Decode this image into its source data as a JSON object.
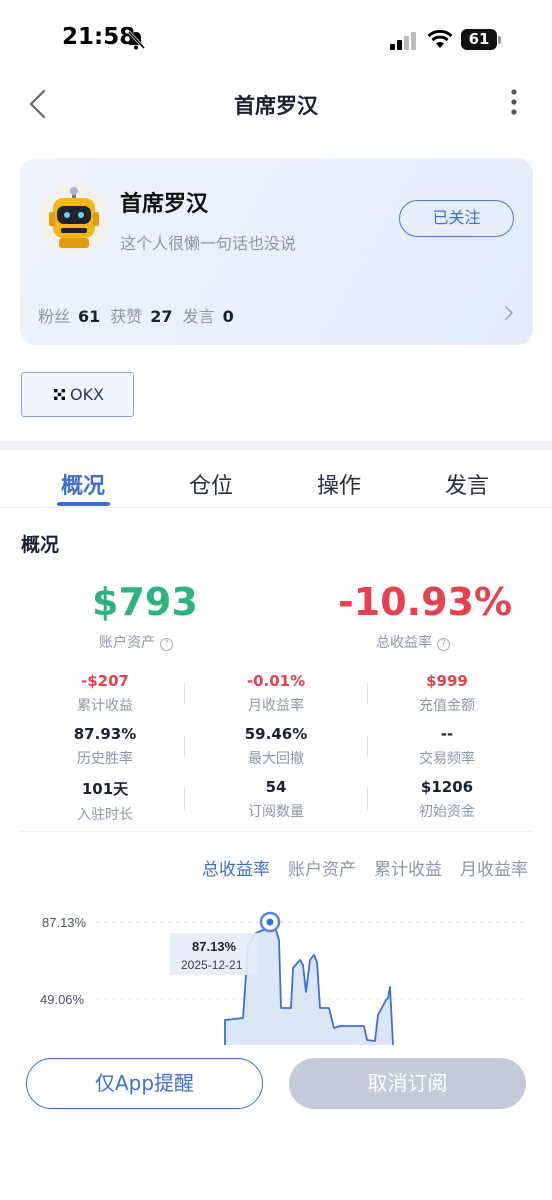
{
  "status": {
    "time": "21:58",
    "battery": "61"
  },
  "nav": {
    "title": "首席罗汉"
  },
  "profile": {
    "name": "首席罗汉",
    "bio": "这个人很懒一句话也没说",
    "follow_label": "已关注",
    "stats": [
      {
        "label": "粉丝",
        "value": "61"
      },
      {
        "label": "获赞",
        "value": "27"
      },
      {
        "label": "发言",
        "value": "0"
      }
    ]
  },
  "exchange_tag": "OKX",
  "tabs": [
    "概况",
    "仓位",
    "操作",
    "发言"
  ],
  "overview": {
    "title": "概况",
    "account_assets": {
      "value": "$793",
      "label": "账户资产"
    },
    "total_return": {
      "value": "-10.93%",
      "label": "总收益率"
    },
    "metrics": [
      {
        "value": "-$207",
        "label": "累计收益"
      },
      {
        "value": "-0.01%",
        "label": "月收益率"
      },
      {
        "value": "$999",
        "label": "充值金额"
      },
      {
        "value": "87.93%",
        "label": "历史胜率"
      },
      {
        "value": "59.46%",
        "label": "最大回撤"
      },
      {
        "value": "--",
        "label": "交易频率"
      },
      {
        "value": "101天",
        "label": "入驻时长"
      },
      {
        "value": "54",
        "label": "订阅数量"
      },
      {
        "value": "$1206",
        "label": "初始资金"
      }
    ]
  },
  "chart_tabs": [
    "总收益率",
    "账户资产",
    "累计收益",
    "月收益率"
  ],
  "chart_data": {
    "type": "area",
    "y_ticks": [
      "87.13%",
      "49.06%"
    ],
    "tooltip": {
      "value": "87.13%",
      "date": "2025-12-21"
    },
    "colors": {
      "line": "#3d6fcf",
      "fill": "#dbe6f8"
    }
  },
  "actions": {
    "remind_label": "仅App提醒",
    "unsubscribe_label": "取消订阅"
  }
}
